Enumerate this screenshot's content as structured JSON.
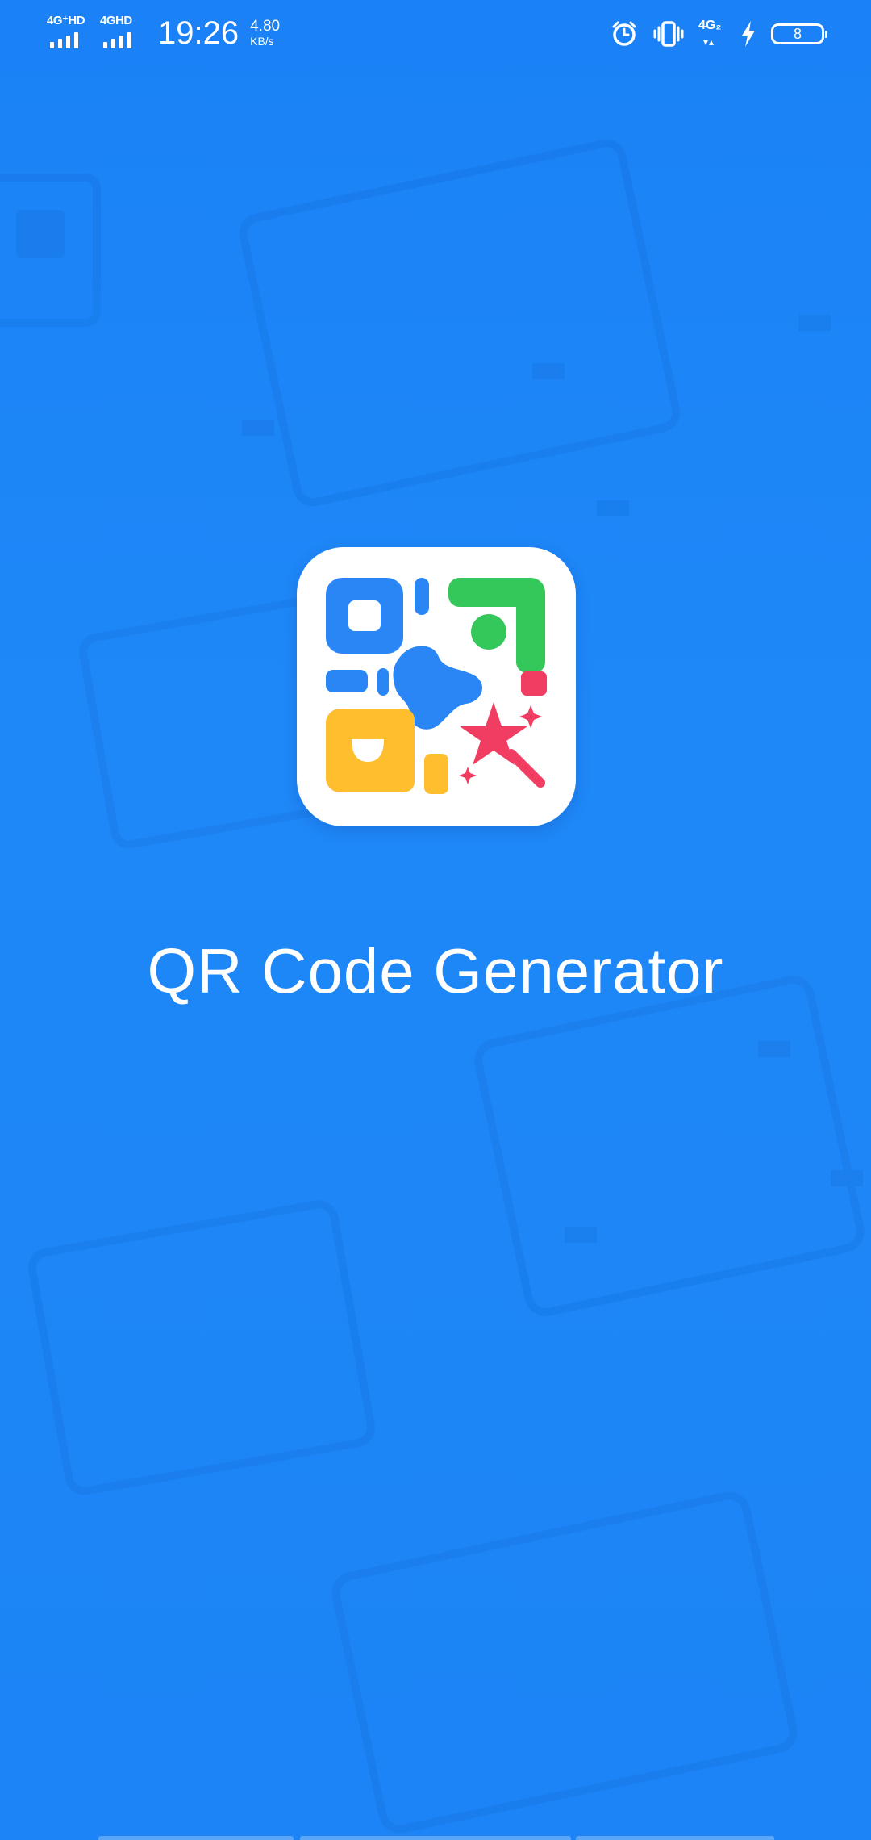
{
  "status_bar": {
    "network1_label": "4G⁺HD",
    "network2_label": "4GHD",
    "time": "19:26",
    "speed_value": "4.80",
    "speed_unit": "KB/s",
    "lte_label": "4G₂",
    "battery_level": "8",
    "icons": [
      "signal-icon",
      "signal-icon",
      "alarm-icon",
      "vibrate-icon",
      "lte-icon",
      "charging-icon",
      "battery-icon"
    ]
  },
  "splash": {
    "app_name": "QR Code Generator",
    "logo_icon": "qr-code-magic-logo",
    "colors": {
      "background": "#1E86F7",
      "logo_blue": "#2A86F5",
      "logo_green": "#34C759",
      "logo_yellow": "#FFBE2E",
      "logo_pink": "#F23D62"
    }
  }
}
